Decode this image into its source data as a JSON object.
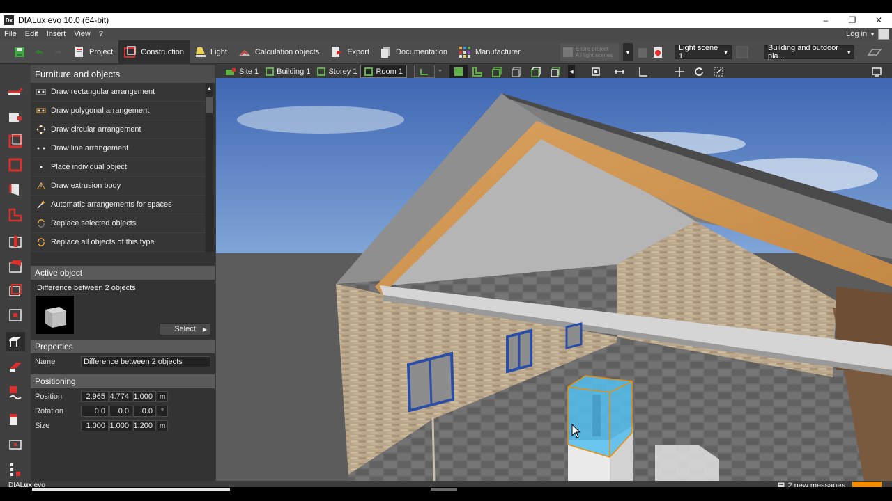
{
  "window": {
    "title": "DIALux evo 10.0  (64-bit)",
    "app_icon_text": "Dx",
    "minimize": "–",
    "maximize": "❐",
    "close": "✕"
  },
  "menu": {
    "items": [
      "File",
      "Edit",
      "Insert",
      "View",
      "?"
    ],
    "login": "Log in"
  },
  "ribbon": {
    "tabs": [
      {
        "label": "Project",
        "active": false
      },
      {
        "label": "Construction",
        "active": true
      },
      {
        "label": "Light",
        "active": false
      },
      {
        "label": "Calculation objects",
        "active": false
      },
      {
        "label": "Export",
        "active": false
      },
      {
        "label": "Documentation",
        "active": false
      },
      {
        "label": "Manufacturer",
        "active": false
      }
    ],
    "entire_project_line1": "Entire project",
    "entire_project_line2": "All light scenes",
    "light_scene": "Light scene 1",
    "building_mode": "Building and outdoor pla..."
  },
  "panel": {
    "title": "Furniture and objects",
    "tools": [
      "Draw rectangular arrangement",
      "Draw polygonal arrangement",
      "Draw circular arrangement",
      "Draw line arrangement",
      "Place individual object",
      "Draw extrusion body",
      "Automatic arrangements for spaces",
      "Replace selected objects",
      "Replace all objects of this type"
    ],
    "active_object_header": "Active object",
    "active_object_name": "Difference between 2 objects",
    "select_label": "Select",
    "properties_header": "Properties",
    "name_label": "Name",
    "name_value": "Difference between 2 objects",
    "positioning_header": "Positioning",
    "position_label": "Position",
    "position": [
      "2.965",
      "4.774",
      "1.000"
    ],
    "position_unit": "m",
    "rotation_label": "Rotation",
    "rotation": [
      "0.0",
      "0.0",
      "0.0"
    ],
    "rotation_unit": "°",
    "size_label": "Size",
    "size": [
      "1.000",
      "1.000",
      "1.200"
    ],
    "size_unit": "m"
  },
  "breadcrumb": [
    {
      "label": "Site 1",
      "active": false
    },
    {
      "label": "Building 1",
      "active": false
    },
    {
      "label": "Storey 1",
      "active": false
    },
    {
      "label": "Room 1",
      "active": true
    }
  ],
  "status": {
    "brand_dia": "DIAL",
    "brand_ux": "ux",
    "brand_evo": " evo",
    "messages": "2 new messages"
  },
  "colors": {
    "accent_green": "#5fb049",
    "accent_red": "#d9302c",
    "notification_orange": "#f28c00",
    "selection_blue": "#54c0f0"
  }
}
